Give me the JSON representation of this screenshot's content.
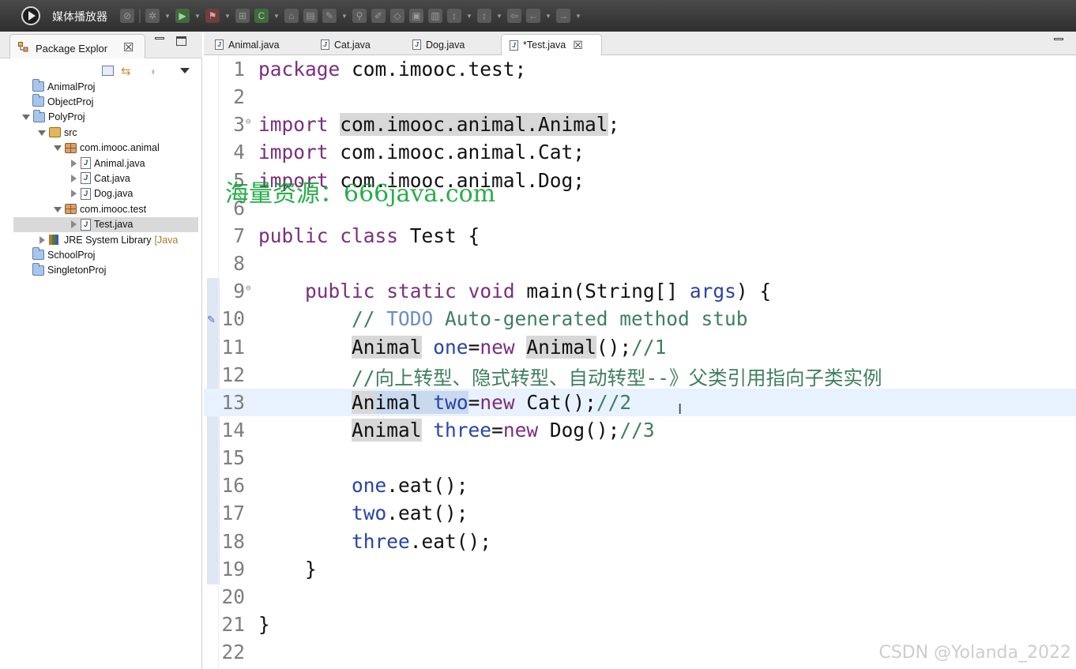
{
  "app": {
    "title": "媒体播放器"
  },
  "explorer": {
    "title": "Package Explor",
    "close": "☒",
    "tree": [
      {
        "label": "AnimalProj",
        "kind": "project",
        "depth": 0,
        "twisty": "none"
      },
      {
        "label": "ObjectProj",
        "kind": "project",
        "depth": 0,
        "twisty": "none"
      },
      {
        "label": "PolyProj",
        "kind": "project",
        "depth": 0,
        "twisty": "open"
      },
      {
        "label": "src",
        "kind": "src",
        "depth": 1,
        "twisty": "open"
      },
      {
        "label": "com.imooc.animal",
        "kind": "package",
        "depth": 2,
        "twisty": "open"
      },
      {
        "label": "Animal.java",
        "kind": "jfile",
        "depth": 3,
        "twisty": "closed"
      },
      {
        "label": "Cat.java",
        "kind": "jfile",
        "depth": 3,
        "twisty": "closed"
      },
      {
        "label": "Dog.java",
        "kind": "jfile",
        "depth": 3,
        "twisty": "closed"
      },
      {
        "label": "com.imooc.test",
        "kind": "package",
        "depth": 2,
        "twisty": "open"
      },
      {
        "label": "Test.java",
        "kind": "jfile",
        "depth": 3,
        "twisty": "closed",
        "selected": true
      },
      {
        "label": "JRE System Library",
        "suffix": "[Java",
        "kind": "library",
        "depth": 1,
        "twisty": "closed"
      },
      {
        "label": "SchoolProj",
        "kind": "project",
        "depth": 0,
        "twisty": "none"
      },
      {
        "label": "SingletonProj",
        "kind": "project",
        "depth": 0,
        "twisty": "none"
      }
    ]
  },
  "editor": {
    "tabs": [
      {
        "label": "Animal.java",
        "active": false
      },
      {
        "label": "Cat.java",
        "active": false
      },
      {
        "label": "Dog.java",
        "active": false
      },
      {
        "label": "*Test.java",
        "active": true
      }
    ],
    "current_line": 13,
    "lines": [
      {
        "n": "1"
      },
      {
        "n": "2"
      },
      {
        "n": "3"
      },
      {
        "n": "4"
      },
      {
        "n": "5"
      },
      {
        "n": "6"
      },
      {
        "n": "7"
      },
      {
        "n": "8"
      },
      {
        "n": "9"
      },
      {
        "n": "10"
      },
      {
        "n": "11"
      },
      {
        "n": "12"
      },
      {
        "n": "13"
      },
      {
        "n": "14"
      },
      {
        "n": "15"
      },
      {
        "n": "16"
      },
      {
        "n": "17"
      },
      {
        "n": "18"
      },
      {
        "n": "19"
      },
      {
        "n": "20"
      },
      {
        "n": "21"
      },
      {
        "n": "22"
      }
    ],
    "code": {
      "l1_kw": "package",
      "l1_rest": " com.imooc.test;",
      "l3_kw": "import",
      "l3_hl": "com.imooc.animal.Animal",
      "l3_end": ";",
      "l4_kw": "import",
      "l4_rest": " com.imooc.animal.Cat;",
      "l5_kw": "import",
      "l5_rest": " com.imooc.animal.Dog;",
      "l7_kw1": "public",
      "l7_kw2": "class",
      "l7_rest": " Test {",
      "l9_kw1": "public",
      "l9_kw2": "static",
      "l9_kw3": "void",
      "l9_mid": " main(String[] ",
      "l9_var": "args",
      "l9_end": ") {",
      "l10_cm1": "// ",
      "l10_todo": "TODO",
      "l10_cm2": " Auto-generated method stub",
      "l11_hl1": "Animal",
      "l11_var": "one",
      "l11_op": "=",
      "l11_kw": "new",
      "l11_hl2": "Animal",
      "l11_end": "();",
      "l11_cm": "//1",
      "l12_cm": "//向上转型、隐式转型、自动转型--》父类引用指向子类实例",
      "l13_hl1": "An",
      "l13_sel1": "imal",
      "l13_sp": " ",
      "l13_var": "two",
      "l13_op": "=",
      "l13_kw": "new",
      "l13_rest": " Cat();",
      "l13_cm": "//2",
      "l14_hl": "Animal",
      "l14_var": "three",
      "l14_op": "=",
      "l14_kw": "new",
      "l14_rest": " Dog();",
      "l14_cm": "//3",
      "l16_var": "one",
      "l16_rest": ".eat();",
      "l17_var": "two",
      "l17_rest": ".eat();",
      "l18_var": "three",
      "l18_rest": ".eat();",
      "l19": "}",
      "l21": "}"
    },
    "watermark": "海量资源：666java.com",
    "source_mark": "CSDN @Yolanda_2022"
  }
}
